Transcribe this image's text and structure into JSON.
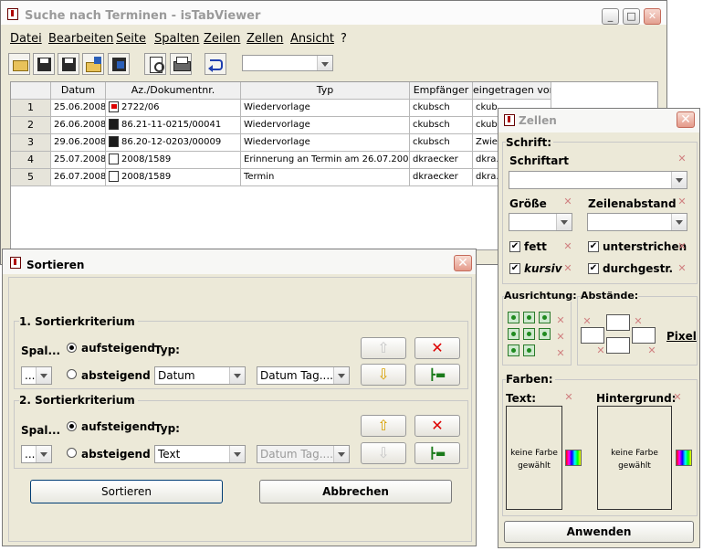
{
  "main_window": {
    "title": "Suche nach Terminen - isTabViewer",
    "menu": [
      "Datei",
      "Bearbeiten",
      "Seite",
      "Spalten",
      "Zeilen",
      "Zellen",
      "Ansicht",
      "?"
    ],
    "toolbar_icons": [
      "open-folder-icon",
      "save-icon",
      "save-as-icon",
      "open-edit-icon",
      "save-blue-icon",
      "print-preview-icon",
      "print-icon",
      "return-icon"
    ],
    "toolbar_combo_value": "",
    "table": {
      "columns": [
        "Datum",
        "Az./Dokumentnr.",
        "Typ",
        "Empfänger",
        "eingetragen von"
      ],
      "rows": [
        {
          "num": "1",
          "datum": "25.06.2008",
          "az": "2722/06",
          "typ": "Wiedervorlage",
          "empf": "ckubsch",
          "eingetr": "ckub..."
        },
        {
          "num": "2",
          "datum": "26.06.2008",
          "az": "86.21-11-0215/00041",
          "typ": "Wiedervorlage",
          "empf": "ckubsch",
          "eingetr": "ckub..."
        },
        {
          "num": "3",
          "datum": "29.06.2008",
          "az": "86.20-12-0203/00009",
          "typ": "Wiedervorlage",
          "empf": "ckubsch",
          "eingetr": "Zwie..."
        },
        {
          "num": "4",
          "datum": "25.07.2008",
          "az": "2008/1589",
          "typ": "Erinnerung an Termin am 26.07.2008",
          "empf": "dkraecker",
          "eingetr": "dkra..."
        },
        {
          "num": "5",
          "datum": "26.07.2008",
          "az": "2008/1589",
          "typ": "Termin",
          "empf": "dkraecker",
          "eingetr": "dkra..."
        }
      ]
    }
  },
  "sort_dialog": {
    "title": "Sortieren",
    "criteria": [
      {
        "heading": "1. Sortierkriterium",
        "spal_label": "Spal...",
        "spal_value": "...",
        "asc_label": "aufsteigend",
        "desc_label": "absteigend",
        "selected": "aufsteigend",
        "typ_label": "Typ:",
        "typ_value": "Datum",
        "format_value": "Datum Tag....",
        "format_disabled": false
      },
      {
        "heading": "2. Sortierkriterium",
        "spal_label": "Spal...",
        "spal_value": "...",
        "asc_label": "aufsteigend",
        "desc_label": "absteigend",
        "selected": "aufsteigend",
        "typ_label": "Typ:",
        "typ_value": "Text",
        "format_value": "Datum Tag....",
        "format_disabled": true
      }
    ],
    "sort_button": "Sortieren",
    "cancel_button": "Abbrechen"
  },
  "cells_panel": {
    "title": "Zellen",
    "schrift_heading": "Schrift:",
    "schriftart_label": "Schriftart",
    "schriftart_value": "",
    "groesse_label": "Größe",
    "zeilenabstand_label": "Zeilenabstand",
    "fett_label": "fett",
    "kursiv_label": "kursiv",
    "unterstrichen_label": "unterstrichen",
    "durchgestr_label": "durchgestr.",
    "ausrichtung_label": "Ausrichtung:",
    "abstaende_label": "Abstände:",
    "pixel_label": "Pixel",
    "farben_heading": "Farben:",
    "text_label": "Text:",
    "hintergrund_label": "Hintergrund:",
    "keine_farbe_text": "keine Farbe gewählt",
    "keine_farbe_bg": "keine Farbe gewählt",
    "apply_button": "Anwenden"
  }
}
